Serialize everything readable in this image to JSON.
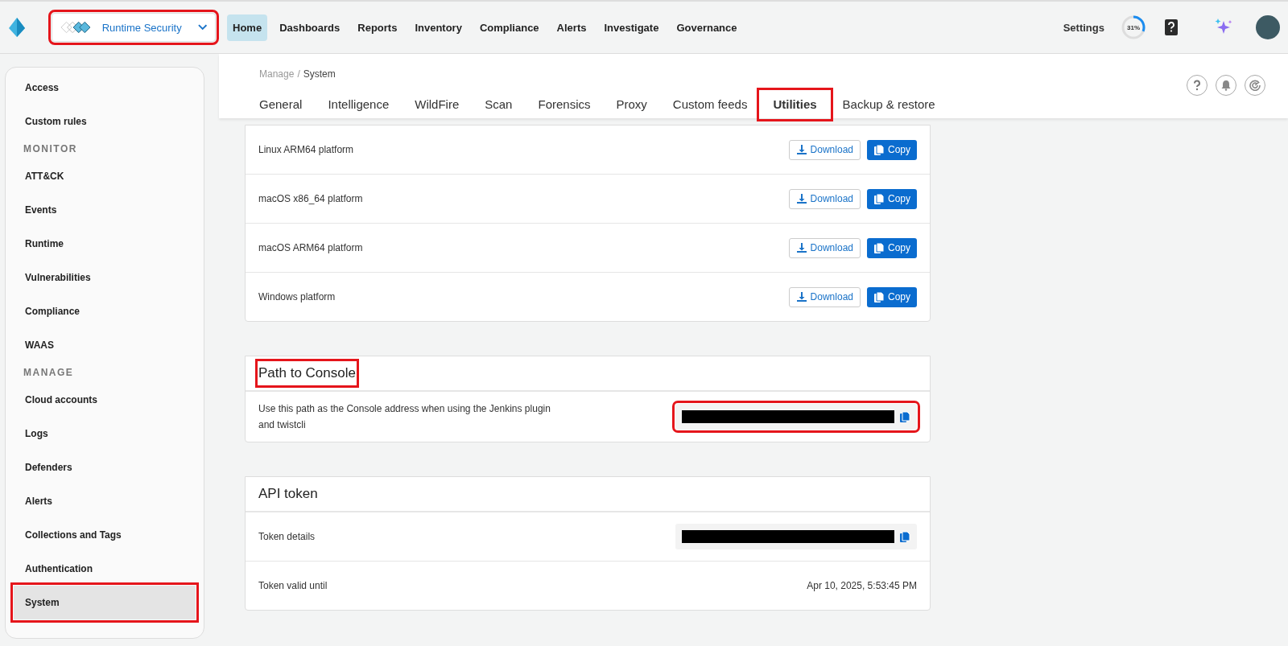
{
  "topbar": {
    "product_switcher": {
      "label": "Runtime Security",
      "highlighted": true
    },
    "nav": [
      {
        "label": "Home",
        "selected": true
      },
      {
        "label": "Dashboards",
        "selected": false
      },
      {
        "label": "Reports",
        "selected": false
      },
      {
        "label": "Inventory",
        "selected": false
      },
      {
        "label": "Compliance",
        "selected": false
      },
      {
        "label": "Alerts",
        "selected": false
      },
      {
        "label": "Investigate",
        "selected": false
      },
      {
        "label": "Governance",
        "selected": false
      }
    ],
    "settings": "Settings",
    "progress": {
      "text": "31%",
      "level": 0.31
    }
  },
  "sidebar": {
    "groups": [
      {
        "items": [
          {
            "label": "Access",
            "selected": false,
            "highlighted": false
          },
          {
            "label": "Custom rules",
            "selected": false,
            "highlighted": false
          }
        ]
      },
      {
        "heading": "MONITOR",
        "items": [
          {
            "label": "ATT&CK",
            "selected": false,
            "highlighted": false
          },
          {
            "label": "Events",
            "selected": false,
            "highlighted": false
          },
          {
            "label": "Runtime",
            "selected": false,
            "highlighted": false
          },
          {
            "label": "Vulnerabilities",
            "selected": false,
            "highlighted": false
          },
          {
            "label": "Compliance",
            "selected": false,
            "highlighted": false
          },
          {
            "label": "WAAS",
            "selected": false,
            "highlighted": false
          }
        ]
      },
      {
        "heading": "MANAGE",
        "items": [
          {
            "label": "Cloud accounts",
            "selected": false,
            "highlighted": false
          },
          {
            "label": "Logs",
            "selected": false,
            "highlighted": false
          },
          {
            "label": "Defenders",
            "selected": false,
            "highlighted": false
          },
          {
            "label": "Alerts",
            "selected": false,
            "highlighted": false
          },
          {
            "label": "Collections and Tags",
            "selected": false,
            "highlighted": false
          },
          {
            "label": "Authentication",
            "selected": false,
            "highlighted": false
          },
          {
            "label": "System",
            "selected": true,
            "highlighted": true
          }
        ]
      }
    ]
  },
  "breadcrumb": {
    "parent": "Manage",
    "separator": "/",
    "current": "System"
  },
  "tabs": [
    {
      "label": "General",
      "selected": false,
      "highlighted": false
    },
    {
      "label": "Intelligence",
      "selected": false,
      "highlighted": false
    },
    {
      "label": "WildFire",
      "selected": false,
      "highlighted": false
    },
    {
      "label": "Scan",
      "selected": false,
      "highlighted": false
    },
    {
      "label": "Forensics",
      "selected": false,
      "highlighted": false
    },
    {
      "label": "Proxy",
      "selected": false,
      "highlighted": false
    },
    {
      "label": "Custom feeds",
      "selected": false,
      "highlighted": false
    },
    {
      "label": "Utilities",
      "selected": true,
      "highlighted": true
    },
    {
      "label": "Backup & restore",
      "selected": false,
      "highlighted": false
    }
  ],
  "platforms": [
    {
      "name": "Linux ARM64 platform",
      "download": "Download",
      "copy": "Copy"
    },
    {
      "name": "macOS x86_64 platform",
      "download": "Download",
      "copy": "Copy"
    },
    {
      "name": "macOS ARM64 platform",
      "download": "Download",
      "copy": "Copy"
    },
    {
      "name": "Windows platform",
      "download": "Download",
      "copy": "Copy"
    }
  ],
  "path_card": {
    "title": "Path to Console",
    "title_highlighted": true,
    "description": "Use this path as the Console address when using the Jenkins plugin and twistcli",
    "field_highlighted": true
  },
  "api_card": {
    "title": "API token",
    "rows": [
      {
        "kind": "secret",
        "label": "Token details"
      },
      {
        "kind": "text",
        "label": "Token valid until",
        "value": "Apr 10, 2025, 5:53:45 PM"
      }
    ]
  }
}
